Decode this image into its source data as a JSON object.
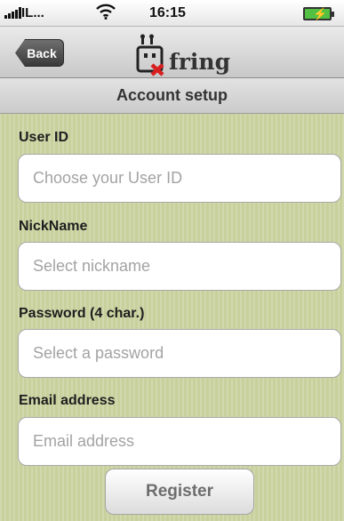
{
  "status": {
    "carrier": "IL...",
    "time": "16:15",
    "battery_level": 1.0,
    "icons": [
      "signal-icon",
      "wifi-icon",
      "battery-icon"
    ]
  },
  "nav": {
    "back_label": "Back",
    "logo_text": "fring"
  },
  "header": {
    "title": "Account setup"
  },
  "form": {
    "user_id_label": "User ID",
    "user_id_placeholder": "Choose your User ID",
    "nickname_label": "NickName",
    "nickname_placeholder": "Select nickname",
    "password_label": "Password (4 char.)",
    "password_placeholder": "Select a password",
    "email_label": "Email address",
    "email_placeholder": "Email address",
    "register_label": "Register"
  },
  "colors": {
    "background": "#c8d09c",
    "back_button": "#4a4a4a",
    "battery": "#52c043",
    "logo_x": "#d81e1e"
  }
}
